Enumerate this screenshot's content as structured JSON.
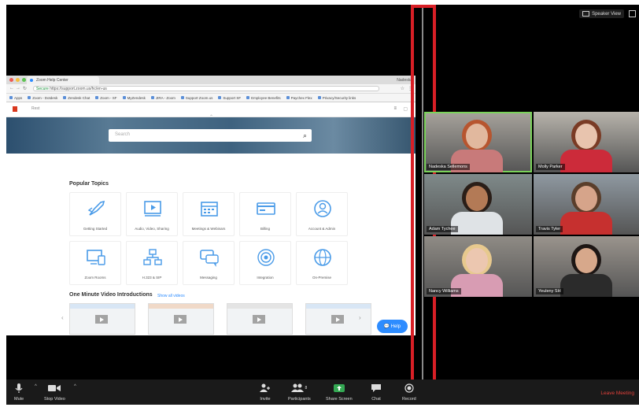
{
  "top_controls": {
    "speaker_view": "Speaker View"
  },
  "shared_screen": {
    "browser": {
      "tab_title": "Zoom Help Center",
      "profile_name": "Nadeska",
      "url_secure": "Secure",
      "url": "https://support.zoom.us/hc/en-us",
      "bookmarks": [
        "Apps",
        "Zoom - Dotdesk",
        "Zendesk Chat",
        "Zoom - SF",
        "MyZendesk",
        "JIRA - Zoom",
        "Support Zoom.us",
        "Support SF",
        "Employee Benefits",
        "Paychex Flex",
        "Privacy/Security links"
      ]
    },
    "site": {
      "nav_text": "Rest",
      "search_placeholder": "Search",
      "popular_topics_title": "Popular Topics",
      "topics": [
        {
          "label": "Getting Started",
          "icon": "rocket-icon"
        },
        {
          "label": "Audio, Video, Sharing",
          "icon": "video-player-icon"
        },
        {
          "label": "Meetings & Webinars",
          "icon": "calendar-icon"
        },
        {
          "label": "Billing",
          "icon": "credit-card-icon"
        },
        {
          "label": "Account & Admin",
          "icon": "user-circle-icon"
        },
        {
          "label": "Zoom Rooms",
          "icon": "devices-icon"
        },
        {
          "label": "H.323 & SIP",
          "icon": "network-icon"
        },
        {
          "label": "Messaging",
          "icon": "chat-icon"
        },
        {
          "label": "Integration",
          "icon": "target-icon"
        },
        {
          "label": "On-Premise",
          "icon": "globe-icon"
        }
      ],
      "videos_title": "One Minute Video Introductions",
      "show_all": "Show all videos",
      "help_button": "Help"
    }
  },
  "participants": [
    {
      "name": "Nadeska Sellemons",
      "active": true,
      "bg": "#a7a39c",
      "skin": "#e1b89e",
      "hair": "#b7552f",
      "shirt": "#c87a7a"
    },
    {
      "name": "Molly Parker",
      "active": false,
      "bg": "#b7b3ab",
      "skin": "#e8c4ae",
      "hair": "#7a3b25",
      "shirt": "#cc2b3a"
    },
    {
      "name": "Adam Tychee",
      "active": false,
      "bg": "#7f8a8a",
      "skin": "#b37a56",
      "hair": "#2a1e18",
      "shirt": "#dfe3e6"
    },
    {
      "name": "Travis Tyler",
      "active": false,
      "bg": "#8f99a1",
      "skin": "#d6a48a",
      "hair": "#5a3e2b",
      "shirt": "#c6302f"
    },
    {
      "name": "Nancy Williams",
      "active": false,
      "bg": "#8f8b85",
      "skin": "#ecc7b0",
      "hair": "#e7c98e",
      "shirt": "#d89cb3"
    },
    {
      "name": "Yeuleny SH",
      "active": false,
      "bg": "#9a948d",
      "skin": "#d7a88b",
      "hair": "#1d1614",
      "shirt": "#2b2b2b"
    }
  ],
  "toolbar": {
    "mute": "Mute",
    "stop_video": "Stop Video",
    "invite": "Invite",
    "participants": "Participants",
    "participants_count": "8",
    "share_screen": "Share Screen",
    "chat": "Chat",
    "record": "Record",
    "leave_meeting": "Leave Meeting"
  },
  "colors": {
    "accent": "#2d8cff",
    "highlight": "#d81f26",
    "leave": "#e0403a",
    "share": "#34a853"
  }
}
